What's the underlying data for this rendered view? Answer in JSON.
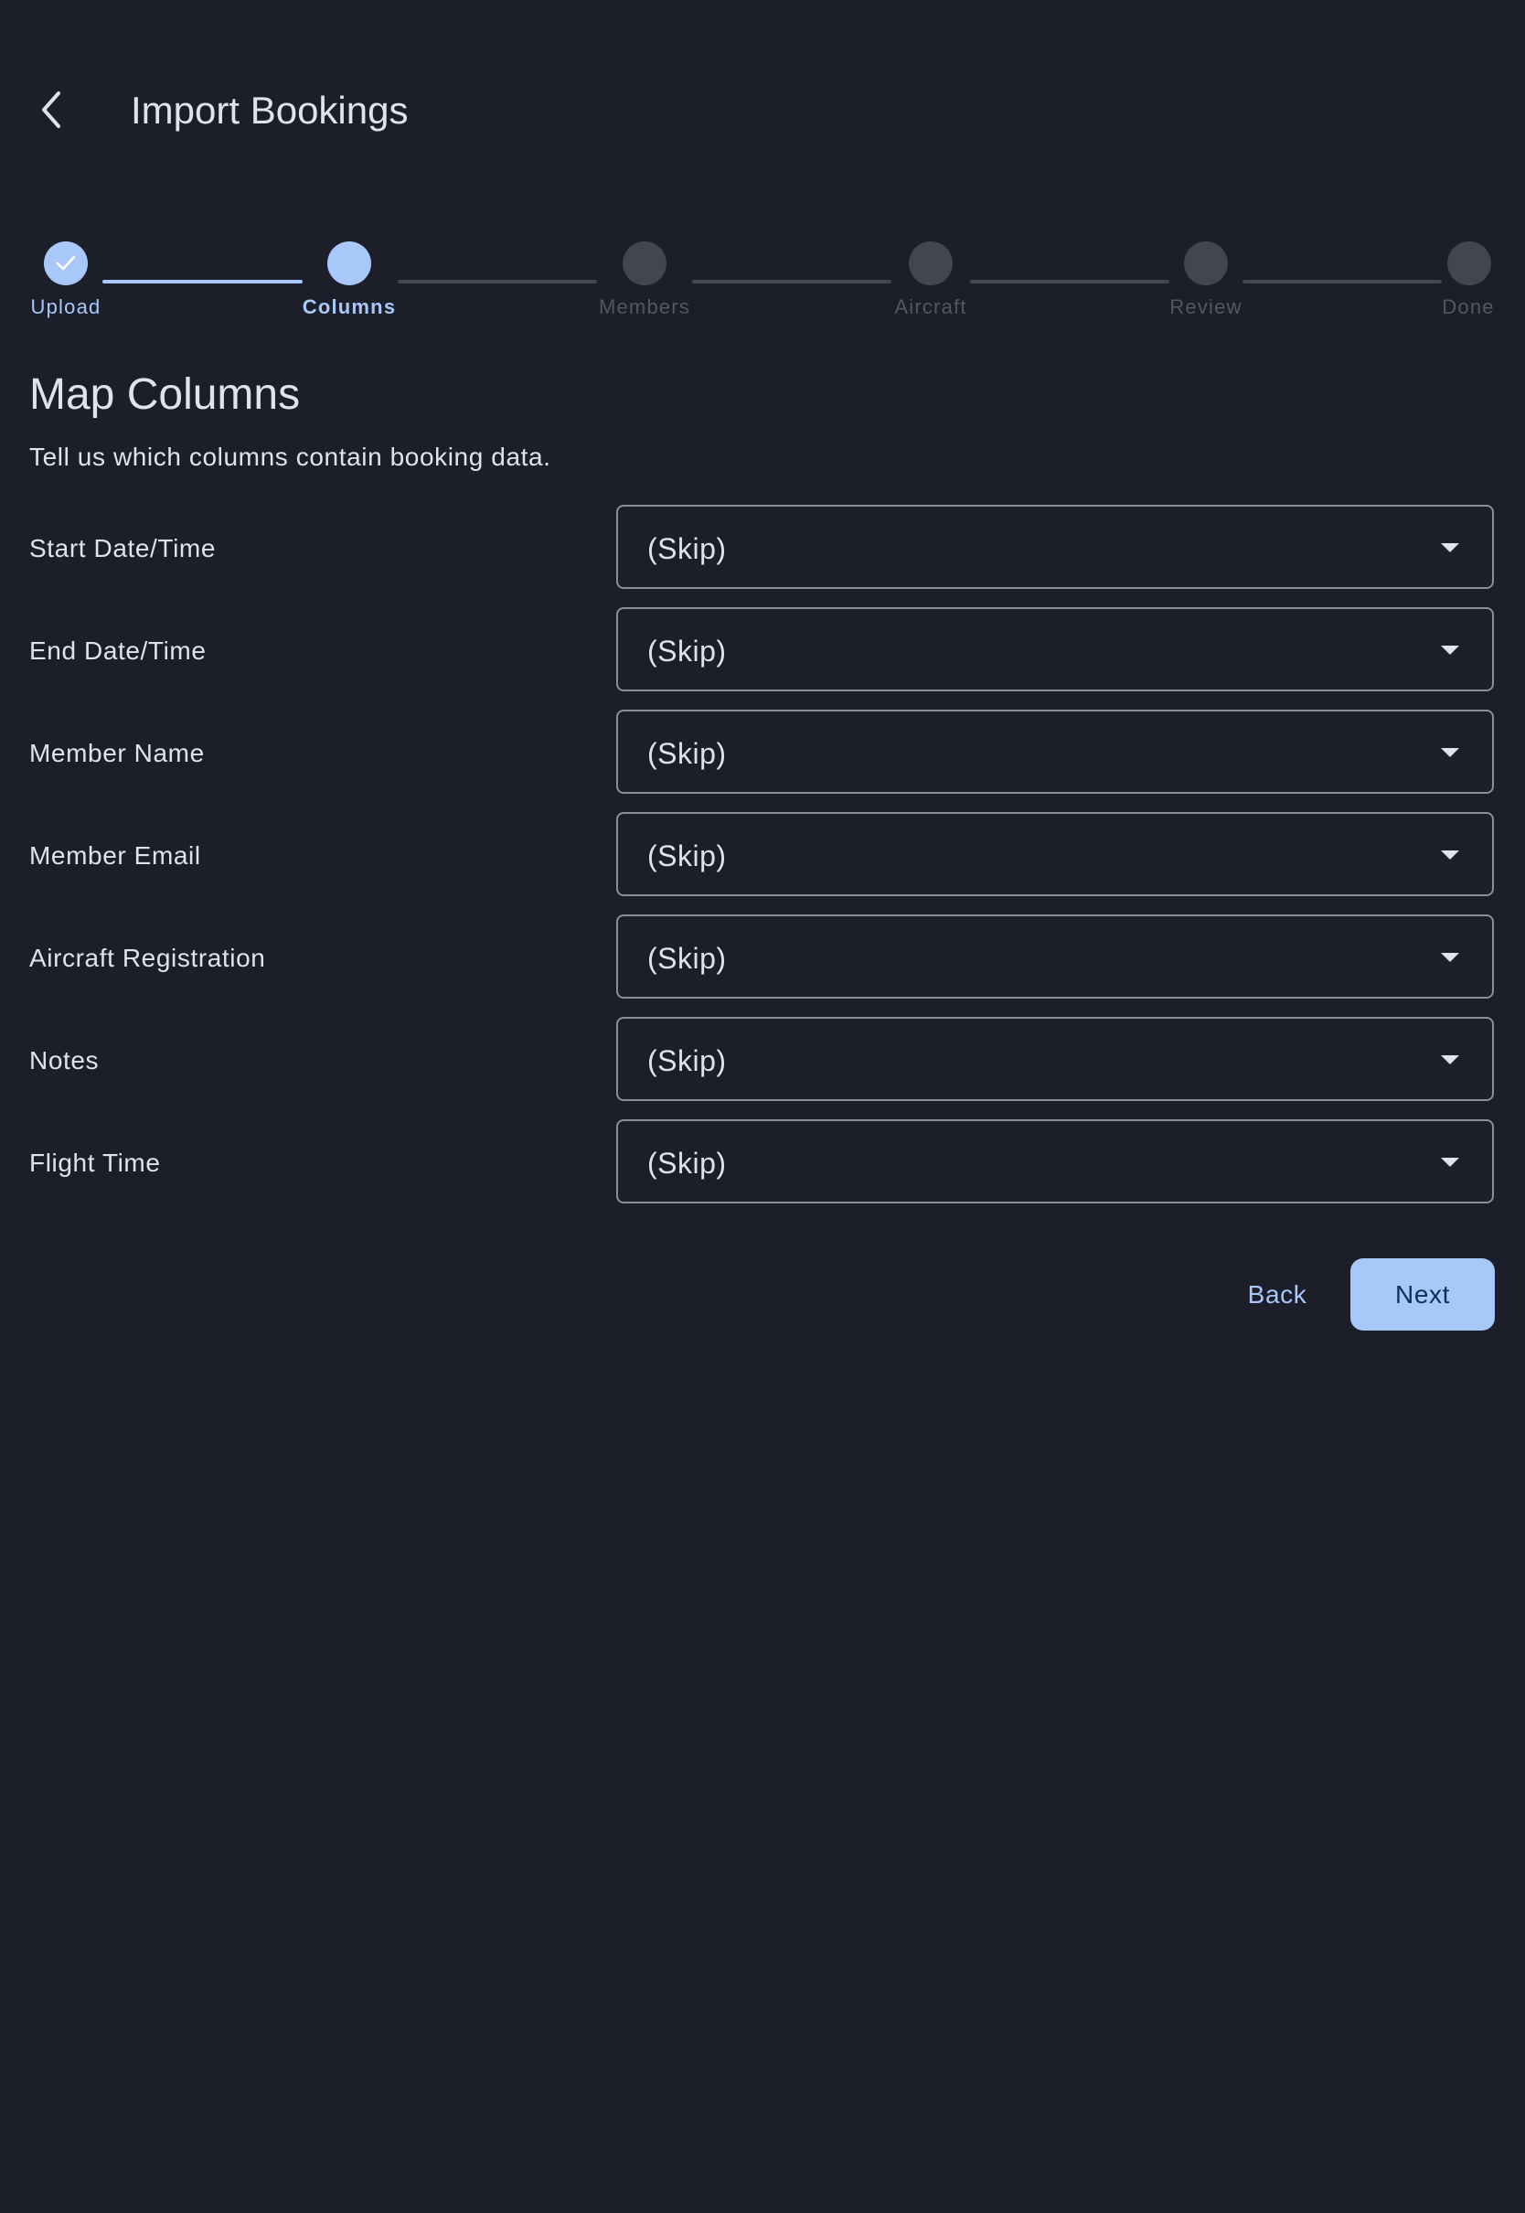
{
  "header": {
    "title": "Import Bookings",
    "back_icon": "chevron-left-icon"
  },
  "stepper": {
    "steps": [
      {
        "label": "Upload",
        "state": "complete"
      },
      {
        "label": "Columns",
        "state": "active"
      },
      {
        "label": "Members",
        "state": "pending"
      },
      {
        "label": "Aircraft",
        "state": "pending"
      },
      {
        "label": "Review",
        "state": "pending"
      },
      {
        "label": "Done",
        "state": "pending"
      }
    ],
    "check_icon": "check-icon"
  },
  "section": {
    "title": "Map Columns",
    "subtitle": "Tell us which columns contain booking data."
  },
  "mappings": [
    {
      "label": "Start Date/Time",
      "value": "(Skip)"
    },
    {
      "label": "End Date/Time",
      "value": "(Skip)"
    },
    {
      "label": "Member Name",
      "value": "(Skip)"
    },
    {
      "label": "Member Email",
      "value": "(Skip)"
    },
    {
      "label": "Aircraft Registration",
      "value": "(Skip)"
    },
    {
      "label": "Notes",
      "value": "(Skip)"
    },
    {
      "label": "Flight Time",
      "value": "(Skip)"
    }
  ],
  "actions": {
    "back_label": "Back",
    "next_label": "Next"
  },
  "colors": {
    "background": "#1c1f29",
    "accent": "#a8c8fa",
    "text": "#e2e2e9",
    "outline": "#8e9099",
    "inactive": "#44464f"
  }
}
